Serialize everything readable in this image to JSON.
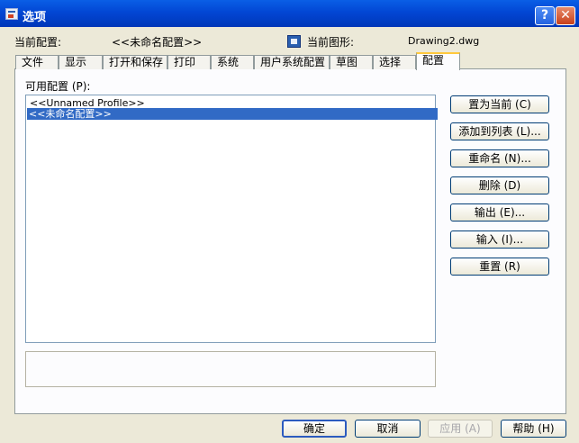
{
  "window": {
    "title": "选项",
    "help_glyph": "?",
    "close_glyph": "✕"
  },
  "header": {
    "profile_label": "当前配置:",
    "profile_value": "<<未命名配置>>",
    "drawing_label": "当前图形:",
    "drawing_value": "Drawing2.dwg"
  },
  "tabs": [
    "文件",
    "显示",
    "打开和保存",
    "打印",
    "系统",
    "用户系统配置",
    "草图",
    "选择",
    "配置"
  ],
  "active_tab": "配置",
  "profiles": {
    "label": "可用配置 (P):",
    "items": [
      "<<Unnamed Profile>>",
      "<<未命名配置>>"
    ],
    "selected_index": 1
  },
  "side_buttons": {
    "set_current": "置为当前 (C)",
    "add_to_list": "添加到列表 (L)...",
    "rename": "重命名 (N)...",
    "delete": "删除 (D)",
    "export": "输出 (E)...",
    "import": "输入 (I)...",
    "reset": "重置 (R)"
  },
  "footer": {
    "ok": "确定",
    "cancel": "取消",
    "apply": "应用 (A)",
    "help": "帮助 (H)"
  },
  "colors": {
    "titlebar": "#0246d4",
    "selection": "#316ac5",
    "active_tab_accent": "#ffc83c"
  }
}
